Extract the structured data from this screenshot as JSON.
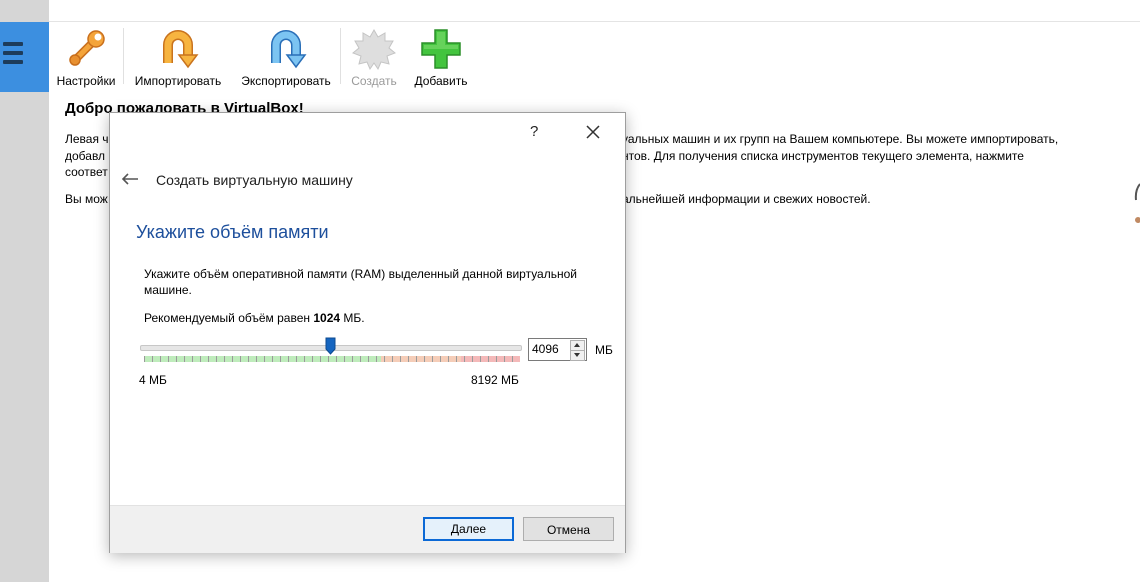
{
  "toolbar": {
    "settings_label": "Настройки",
    "import_label": "Импортировать",
    "export_label": "Экспортировать",
    "create_label": "Создать",
    "add_label": "Добавить"
  },
  "welcome": {
    "title": "Добро пожаловать в VirtualBox!",
    "p1_left_line1": "Левая ч",
    "p1_left_line2": "добавл",
    "p1_left_line3": "соответ",
    "p1_right_line1": "уальных машин и их групп на Вашем компьютере. Вы можете импортировать,",
    "p1_right_line2": "нтов. Для получения списка инструментов текущего элемента, нажмите",
    "p2_left": "Вы мож",
    "p2_right": "альнейшей информации и свежих новостей."
  },
  "dialog": {
    "help": "?",
    "title": "Создать виртуальную машину",
    "heading": "Укажите объём памяти",
    "description": "Укажите объём оперативной памяти (RAM) выделенный данной виртуальной машине.",
    "recommended_prefix": "Рекомендуемый объём равен ",
    "recommended_value": "1024",
    "recommended_suffix": " МБ.",
    "memory": {
      "value": "4096",
      "unit": "МБ",
      "min_label": "4 МБ",
      "max_label": "8192 МБ",
      "slider_fraction": 0.5
    },
    "next_label": "Далее",
    "cancel_label": "Отмена"
  },
  "colors": {
    "accent": "#3c8fe0",
    "heading": "#1d4f9c",
    "slider_handle": "#1565c0"
  }
}
